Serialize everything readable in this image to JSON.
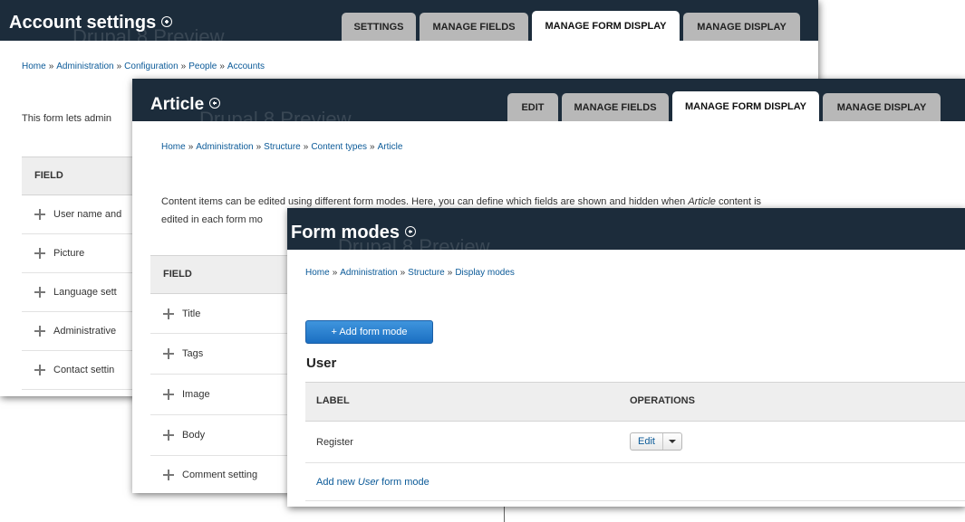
{
  "watermark": "Drupal 8 Preview",
  "account": {
    "title": "Account settings",
    "tabs": [
      "SETTINGS",
      "MANAGE FIELDS",
      "MANAGE FORM DISPLAY",
      "MANAGE DISPLAY"
    ],
    "active_tab": 2,
    "breadcrumb": [
      "Home",
      "Administration",
      "Configuration",
      "People",
      "Accounts"
    ],
    "description": "This form lets admin",
    "field_header": "FIELD",
    "fields": [
      "User name and",
      "Picture",
      "Language sett",
      "Administrative",
      "Contact settin"
    ]
  },
  "article": {
    "title": "Article",
    "tabs": [
      "EDIT",
      "MANAGE FIELDS",
      "MANAGE FORM DISPLAY",
      "MANAGE DISPLAY"
    ],
    "active_tab": 2,
    "breadcrumb": [
      "Home",
      "Administration",
      "Structure",
      "Content types",
      "Article"
    ],
    "description_line1": "Content items can be edited using different form modes. Here, you can define which fields are shown and hidden when",
    "description_em": "Article",
    "description_line1_end": "content is",
    "description_line2": "edited in each form mo",
    "field_header": "FIELD",
    "fields": [
      "Title",
      "Tags",
      "Image",
      "Body",
      "Comment setting"
    ]
  },
  "formmodes": {
    "title": "Form modes",
    "breadcrumb": [
      "Home",
      "Administration",
      "Structure",
      "Display modes"
    ],
    "add_button": "+ Add form mode",
    "section_title": "User",
    "col_label": "LABEL",
    "col_operations": "OPERATIONS",
    "rows": [
      {
        "label": "Register",
        "operation": "Edit"
      }
    ],
    "add_link_prefix": "Add new",
    "add_link_em": "User",
    "add_link_suffix": "form mode"
  }
}
